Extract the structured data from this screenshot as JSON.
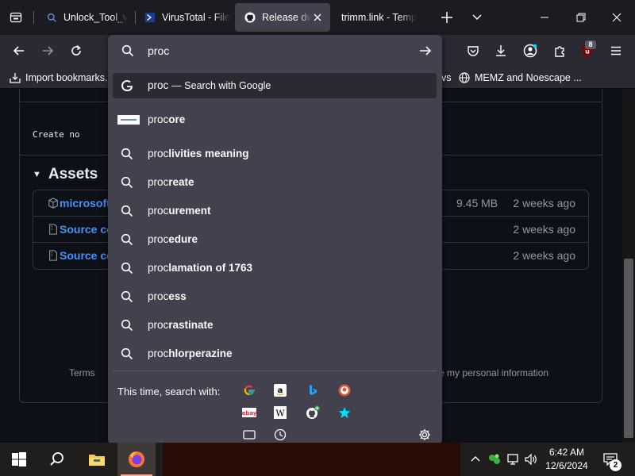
{
  "tabs": [
    {
      "title": "Unlock_Tool_v",
      "favicon": "search-icon"
    },
    {
      "title": "VirusTotal - File",
      "favicon": "virustotal-icon"
    },
    {
      "title": "Release dwd",
      "favicon": "github-icon",
      "active": true
    },
    {
      "title": "trimm.link - Temp",
      "favicon": ""
    }
  ],
  "urlbar": {
    "typed": "proc",
    "selected": {
      "prefix": "proc",
      "separator": "—",
      "action": "Search with Google"
    },
    "site_suggestion": {
      "typed": "proc",
      "completion": "ore"
    },
    "suggestions": [
      {
        "typed": "proc",
        "completion": "livities meaning"
      },
      {
        "typed": "proc",
        "completion": "reate"
      },
      {
        "typed": "proc",
        "completion": "urement"
      },
      {
        "typed": "proc",
        "completion": "edure"
      },
      {
        "typed": "proc",
        "completion": "lamation of 1763"
      },
      {
        "typed": "proc",
        "completion": "ess"
      },
      {
        "typed": "proc",
        "completion": "rastinate"
      },
      {
        "typed": "proc",
        "completion": "hlorperazine"
      }
    ],
    "search_with_label": "This time, search with:",
    "engines": [
      "google-icon",
      "amazon-icon",
      "bing-icon",
      "duckduckgo-icon",
      "ebay-icon",
      "wikipedia-icon",
      "github-icon",
      "star-icon"
    ],
    "bottom_icons": [
      "tabs-icon",
      "history-icon",
      "settings-icon"
    ]
  },
  "navbar": {
    "ublock_count": "8"
  },
  "bookmarks": {
    "import": "Import bookmarks...",
    "partial": "vs",
    "memz": "MEMZ and Noescape ..."
  },
  "page": {
    "create_note": "Create no",
    "assets_title": "Assets",
    "assets": [
      {
        "name": "microsoft",
        "size": "9.45 MB",
        "date": "2 weeks ago"
      },
      {
        "name": "Source co",
        "size": "",
        "date": "2 weeks ago"
      },
      {
        "name": "Source co",
        "size": "",
        "date": "2 weeks ago"
      }
    ],
    "footer_left": "Terms",
    "footer_right": "e my personal information"
  },
  "taskbar": {
    "time": "6:42 AM",
    "date": "12/6/2024",
    "notifications": "2"
  },
  "colors": {
    "link": "#4493f8",
    "muted": "#9198a1",
    "panel": "#42414d",
    "chrome": "#2b2a33"
  }
}
